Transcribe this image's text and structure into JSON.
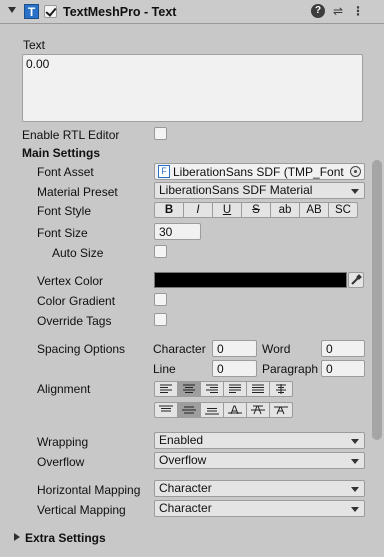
{
  "header": {
    "title": "TextMeshPro - Text",
    "icon_letter": "T"
  },
  "text_label": "Text",
  "text_value": "0.00",
  "enable_rtl_label": "Enable RTL Editor",
  "main_settings_label": "Main Settings",
  "font_asset": {
    "label": "Font Asset",
    "value": "LiberationSans SDF (TMP_Font",
    "icon_letter": "F"
  },
  "material_preset": {
    "label": "Material Preset",
    "value": "LiberationSans SDF Material"
  },
  "font_style": {
    "label": "Font Style",
    "buttons": [
      "B",
      "I",
      "U",
      "S",
      "ab",
      "AB",
      "SC"
    ]
  },
  "font_size": {
    "label": "Font Size",
    "value": "30"
  },
  "auto_size_label": "Auto Size",
  "vertex_color_label": "Vertex Color",
  "vertex_color_value": "#000000",
  "color_gradient_label": "Color Gradient",
  "override_tags_label": "Override Tags",
  "spacing": {
    "label": "Spacing Options",
    "character_label": "Character",
    "character_value": "0",
    "word_label": "Word",
    "word_value": "0",
    "line_label": "Line",
    "line_value": "0",
    "paragraph_label": "Paragraph",
    "paragraph_value": "0"
  },
  "alignment_label": "Alignment",
  "wrapping": {
    "label": "Wrapping",
    "value": "Enabled"
  },
  "overflow": {
    "label": "Overflow",
    "value": "Overflow"
  },
  "horizontal_mapping": {
    "label": "Horizontal Mapping",
    "value": "Character"
  },
  "vertical_mapping": {
    "label": "Vertical Mapping",
    "value": "Character"
  },
  "extra_settings_label": "Extra Settings"
}
